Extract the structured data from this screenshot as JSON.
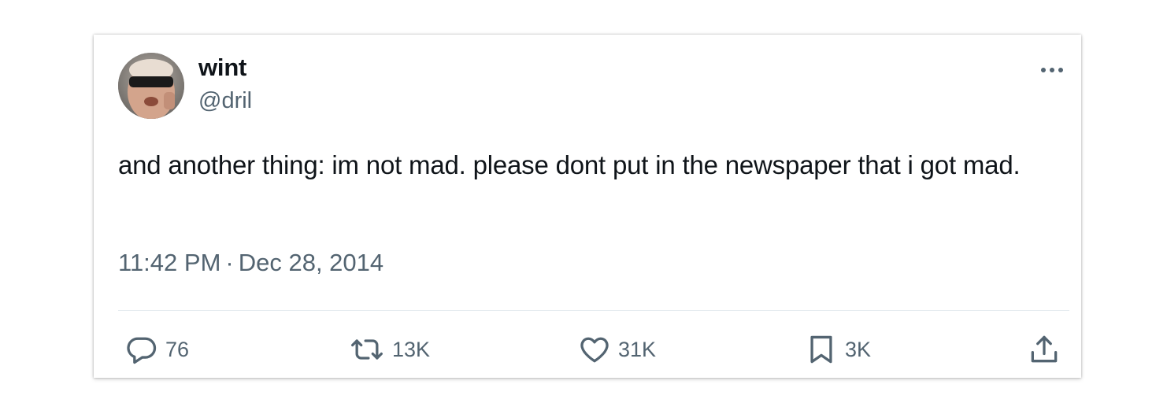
{
  "author": {
    "display_name": "wint",
    "handle": "@dril",
    "avatar_icon": "user-avatar-sunglasses"
  },
  "tweet": {
    "text": "and another thing: im not mad. please dont put in the newspaper that i got mad.",
    "time": "11:42 PM",
    "separator": "·",
    "date": "Dec 28, 2014"
  },
  "menu": {
    "icon": "more-horizontal-icon"
  },
  "actions": {
    "reply": {
      "icon": "reply-icon",
      "count": "76"
    },
    "retweet": {
      "icon": "retweet-icon",
      "count": "13K"
    },
    "like": {
      "icon": "heart-icon",
      "count": "31K"
    },
    "bookmark": {
      "icon": "bookmark-icon",
      "count": "3K"
    },
    "share": {
      "icon": "share-icon"
    }
  },
  "colors": {
    "text_primary": "#0f1419",
    "text_secondary": "#536471",
    "divider": "#e6ecf0"
  }
}
